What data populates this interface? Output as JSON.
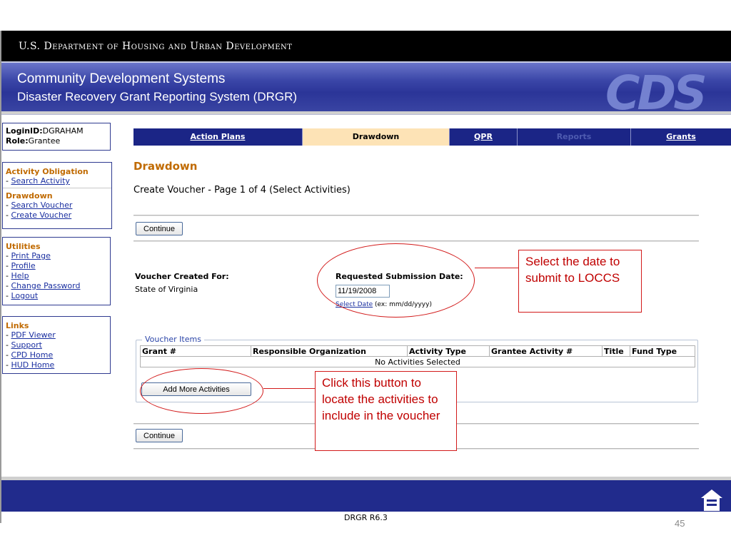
{
  "header": {
    "agency": "U.S. Department of Housing and Urban Development",
    "system_title": "Community Development Systems",
    "system_subtitle": "Disaster Recovery Grant Reporting System (DRGR)",
    "logo_text": "CDS"
  },
  "login": {
    "login_label": "LoginID:",
    "login_value": "DGRAHAM",
    "role_label": "Role:",
    "role_value": "Grantee"
  },
  "sidebar": {
    "activity_obligation": {
      "heading": "Activity Obligation",
      "items": [
        {
          "label": "Search Activity"
        }
      ]
    },
    "drawdown": {
      "heading": "Drawdown",
      "items": [
        {
          "label": "Search Voucher"
        },
        {
          "label": "Create Voucher"
        }
      ]
    },
    "utilities": {
      "heading": "Utilities",
      "items": [
        {
          "label": "Print Page"
        },
        {
          "label": "Profile"
        },
        {
          "label": "Help"
        },
        {
          "label": "Change Password"
        },
        {
          "label": "Logout"
        }
      ]
    },
    "links": {
      "heading": "Links",
      "items": [
        {
          "label": "PDF Viewer"
        },
        {
          "label": "Support"
        },
        {
          "label": "CPD Home"
        },
        {
          "label": "HUD Home"
        }
      ]
    }
  },
  "tabs": [
    {
      "label": "Action Plans",
      "state": "link"
    },
    {
      "label": "Drawdown",
      "state": "active"
    },
    {
      "label": "QPR",
      "state": "link"
    },
    {
      "label": "Reports",
      "state": "disabled"
    },
    {
      "label": "Grants",
      "state": "link"
    }
  ],
  "main": {
    "title": "Drawdown",
    "subtitle": "Create Voucher - Page 1 of 4 (Select Activities)",
    "continue_label": "Continue",
    "voucher_created_for_label": "Voucher Created For:",
    "voucher_created_for_value": "State of Virginia",
    "requested_date_label": "Requested Submission Date:",
    "requested_date_value": "11/19/2008",
    "select_date_link": "Select Date",
    "date_hint": "(ex: mm/dd/yyyy)",
    "voucher_items": {
      "legend": "Voucher Items",
      "columns": [
        "Grant #",
        "Responsible Organization",
        "Activity Type",
        "Grantee Activity #",
        "Title",
        "Fund Type"
      ],
      "empty_message": "No Activities Selected"
    },
    "add_more_label": "Add More Activities"
  },
  "annotations": {
    "date_callout": "Select the date to submit to LOCCS",
    "button_callout": "Click this button to locate the activities to include in the voucher"
  },
  "footer": {
    "version": "DRGR R6.3",
    "slide_number": "45"
  },
  "colors": {
    "nav_blue": "#1b2586",
    "accent_orange": "#c06a00",
    "active_tab": "#fde3b6",
    "annotation_red": "#d21a1a"
  }
}
